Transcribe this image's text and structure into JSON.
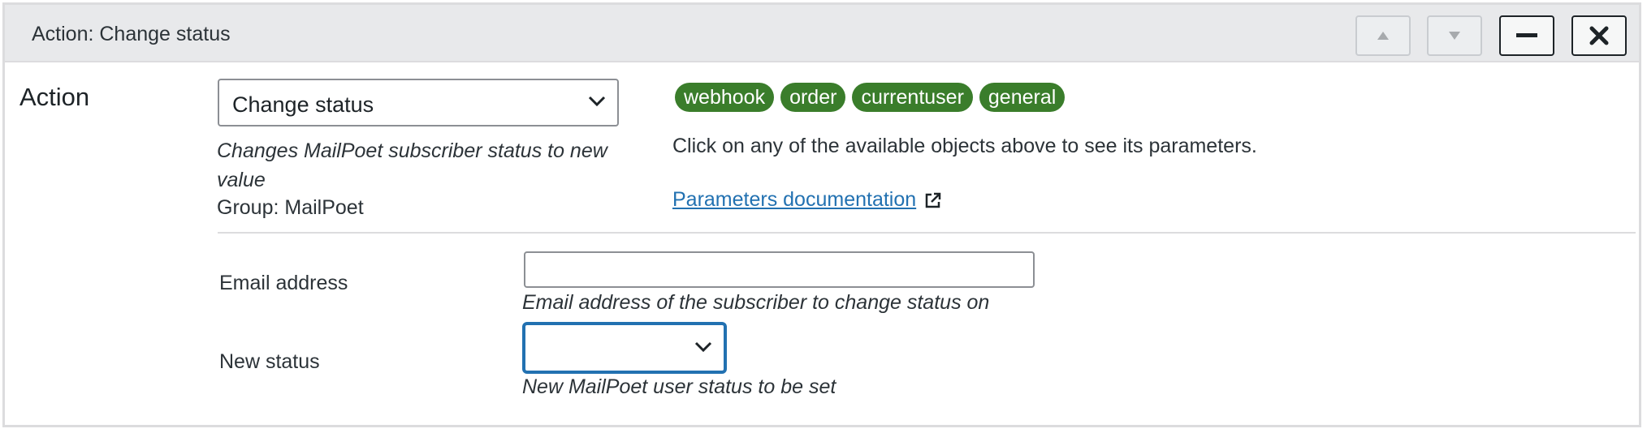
{
  "header": {
    "title": "Action: Change status",
    "buttons": [
      {
        "name": "move-up",
        "icon": "triangle-up-icon",
        "state": "disabled"
      },
      {
        "name": "move-down",
        "icon": "triangle-down-icon",
        "state": "disabled"
      },
      {
        "name": "collapse",
        "icon": "minus-icon",
        "state": "enabled"
      },
      {
        "name": "remove",
        "icon": "close-icon",
        "state": "enabled"
      }
    ]
  },
  "action": {
    "label": "Action",
    "selected": "Change status",
    "description": "Changes MailPoet subscriber status to new value",
    "group": "Group: MailPoet"
  },
  "objects": {
    "tags": [
      "webhook",
      "order",
      "currentuser",
      "general"
    ],
    "hint": "Click on any of the available objects above to see its parameters.",
    "doc_link": "Parameters documentation"
  },
  "fields": {
    "email": {
      "label": "Email address",
      "value": "",
      "description": "Email address of the subscriber to change status on"
    },
    "status": {
      "label": "New status",
      "value": "",
      "description": "New MailPoet user status to be set"
    }
  },
  "colors": {
    "tag_bg": "#3a7d2b",
    "link": "#2271b1",
    "focus": "#2271b1",
    "header_bg": "#e8e9eb"
  }
}
